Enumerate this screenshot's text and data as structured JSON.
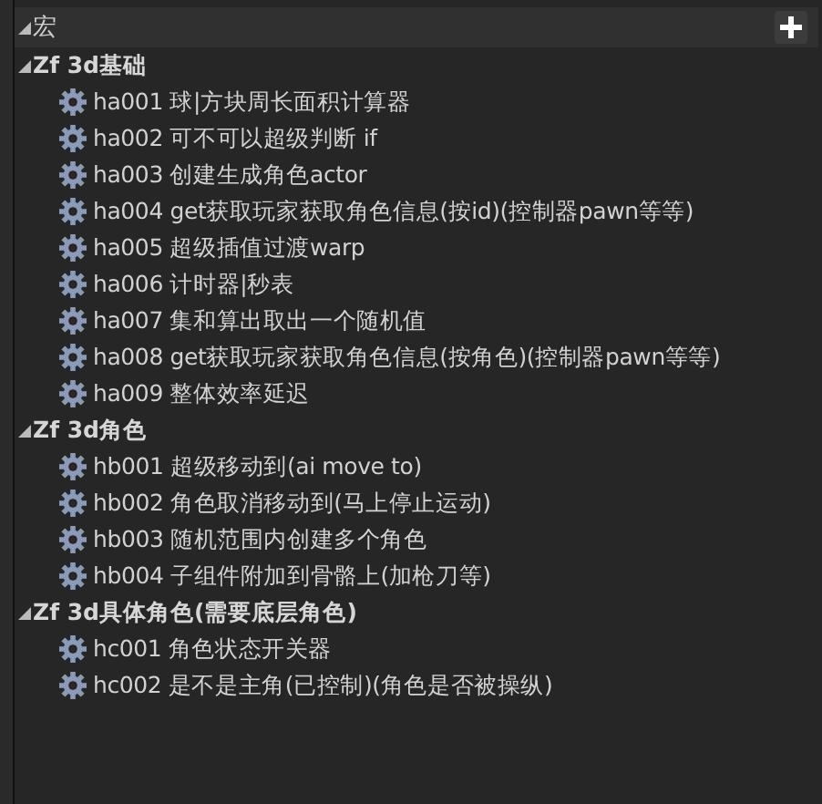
{
  "section": {
    "title": "宏",
    "expanded": true
  },
  "groups": [
    {
      "label": "Zf 3d基础",
      "expanded": true,
      "children": [
        {
          "label": "ha001 球|方块周长面积计算器"
        },
        {
          "label": "ha002 可不可以超级判断 if"
        },
        {
          "label": "ha003 创建生成角色actor"
        },
        {
          "label": "ha004 get获取玩家获取角色信息(按id)(控制器pawn等等)"
        },
        {
          "label": "ha005 超级插值过渡warp"
        },
        {
          "label": "ha006 计时器|秒表"
        },
        {
          "label": "ha007 集和算出取出一个随机值"
        },
        {
          "label": "ha008 get获取玩家获取角色信息(按角色)(控制器pawn等等)"
        },
        {
          "label": "ha009 整体效率延迟"
        }
      ]
    },
    {
      "label": "Zf 3d角色",
      "expanded": true,
      "children": [
        {
          "label": "hb001 超级移动到(ai move to)"
        },
        {
          "label": "hb002 角色取消移动到(马上停止运动)"
        },
        {
          "label": "hb003 随机范围内创建多个角色"
        },
        {
          "label": "hb004 子组件附加到骨骼上(加枪刀等)"
        }
      ]
    },
    {
      "label": "Zf 3d具体角色(需要底层角色)",
      "expanded": true,
      "children": [
        {
          "label": "hc001 角色状态开关器"
        },
        {
          "label": "hc002 是不是主角(已控制)(角色是否被操纵)"
        }
      ]
    }
  ]
}
